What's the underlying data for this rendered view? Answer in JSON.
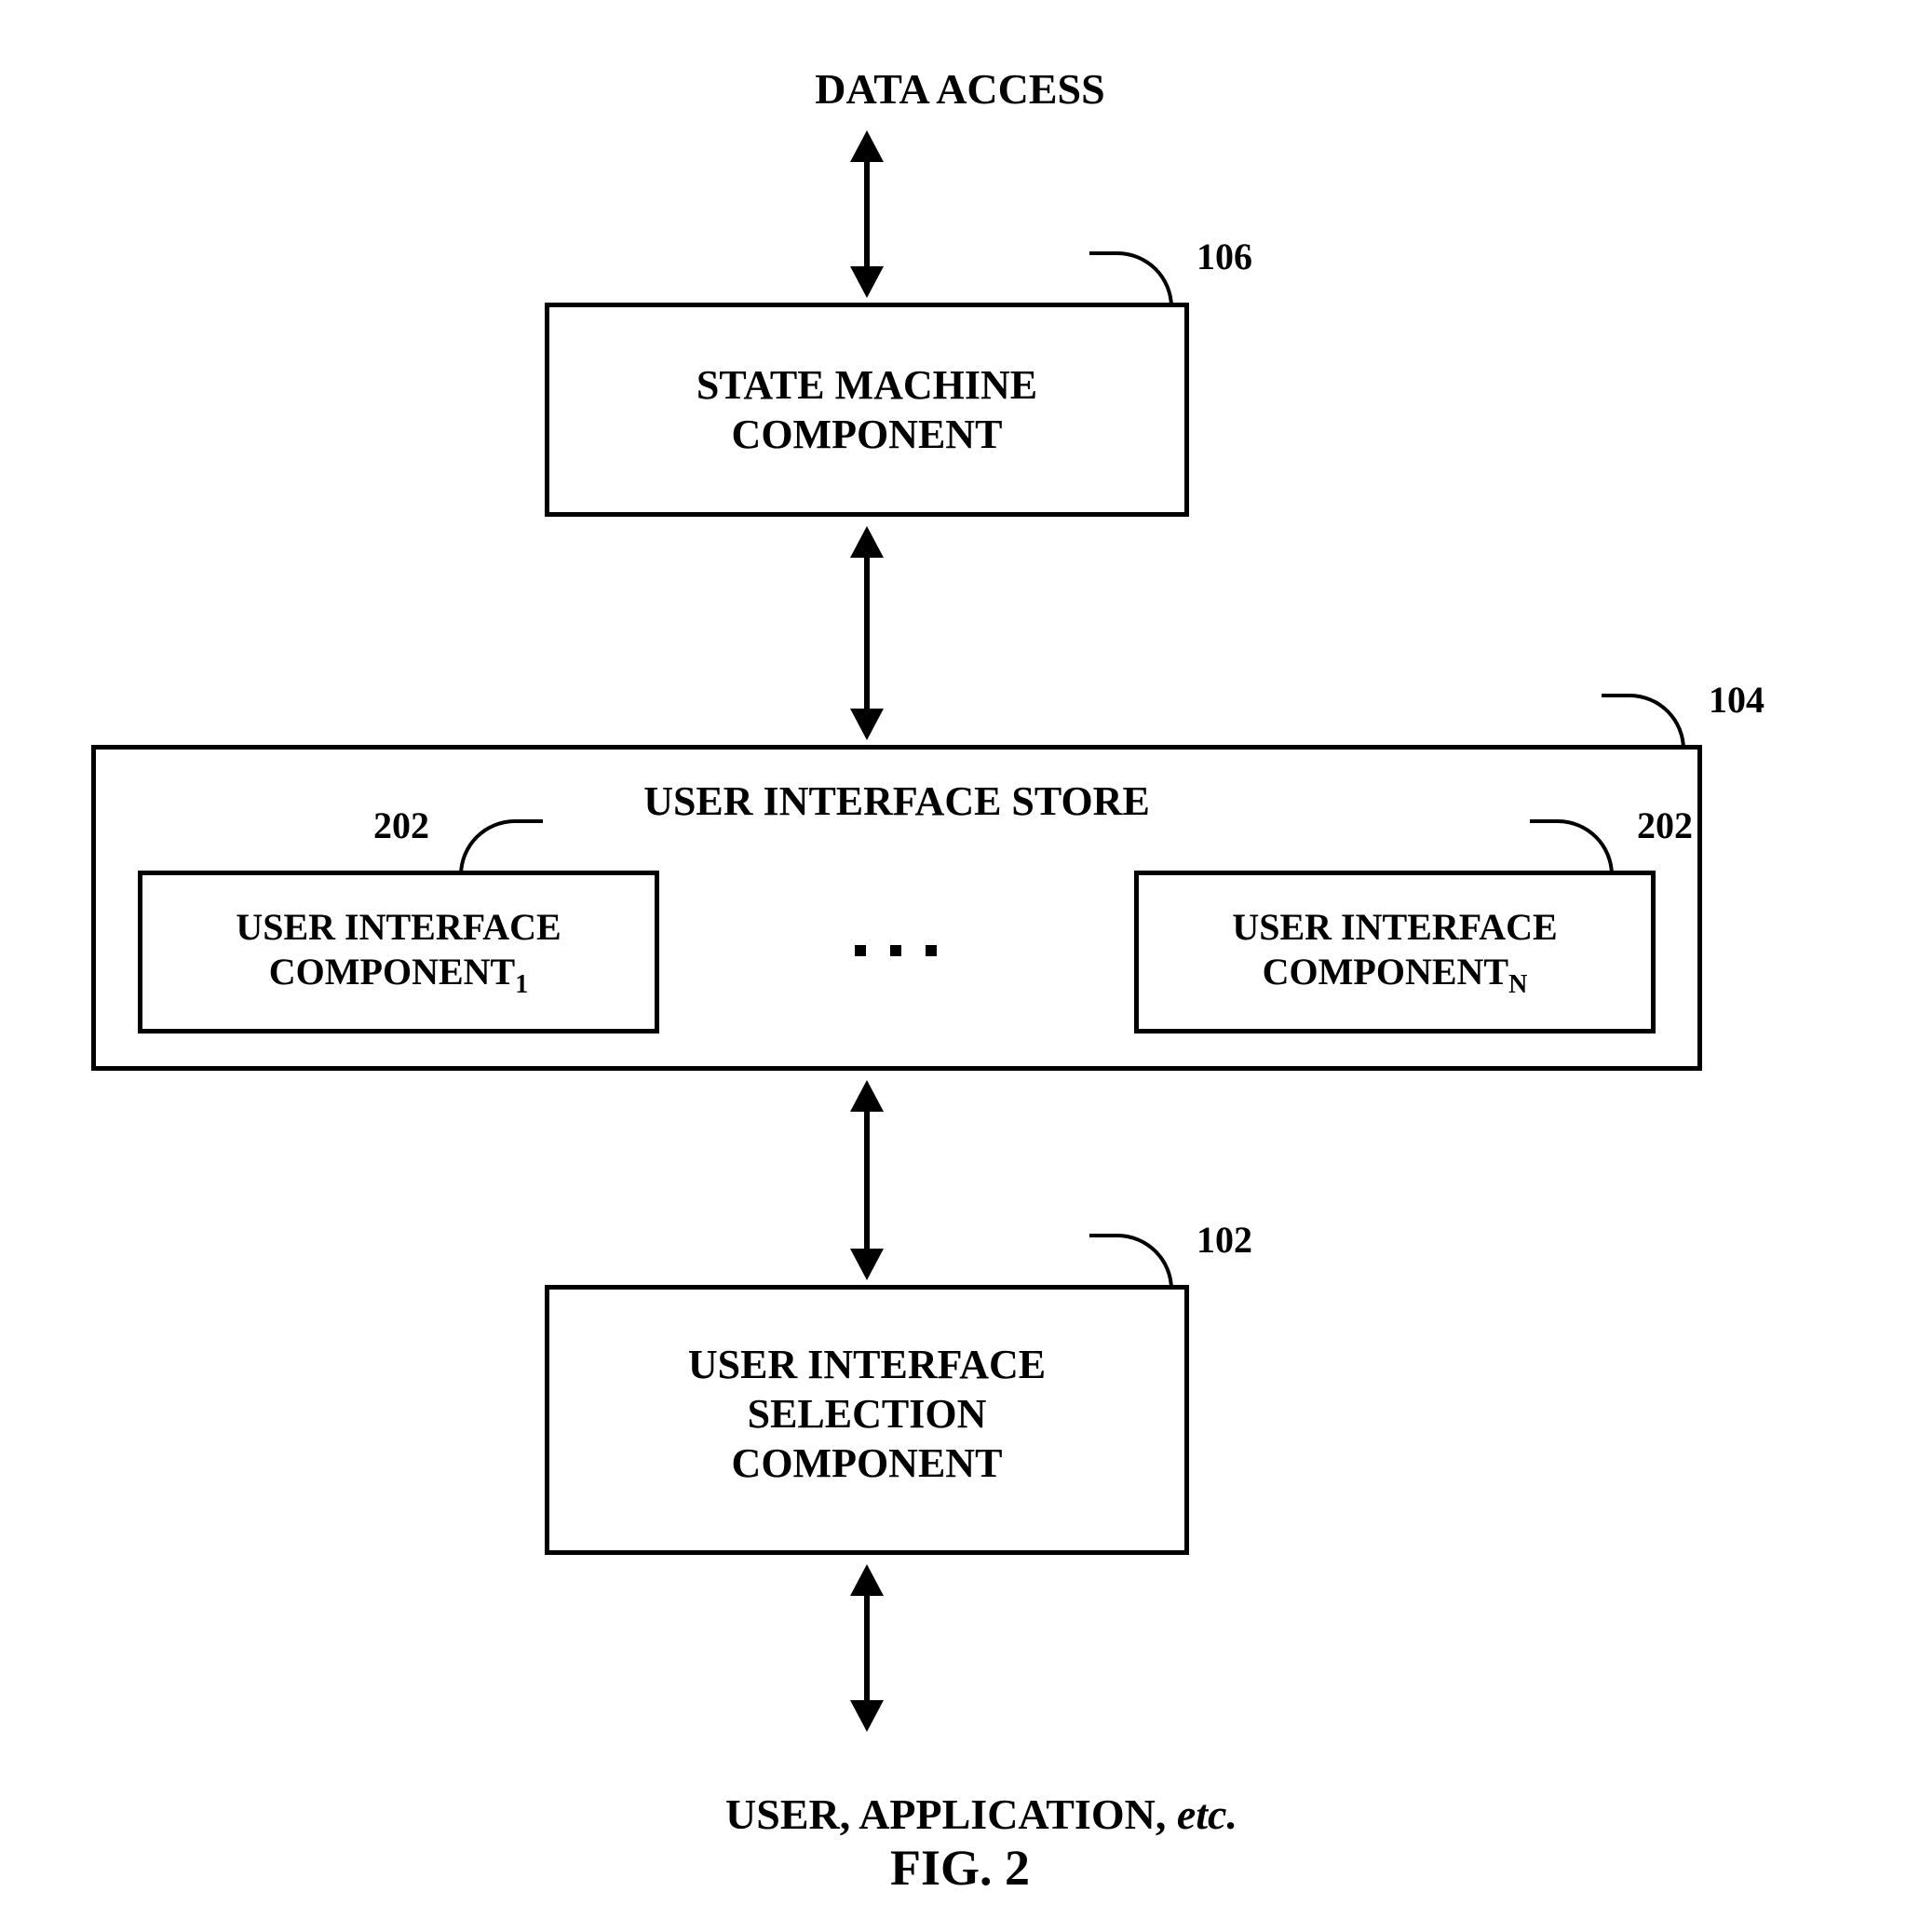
{
  "top_label": "DATA ACCESS",
  "state_machine": {
    "line1": "STATE MACHINE",
    "line2": "COMPONENT",
    "ref": "106"
  },
  "ui_store": {
    "title": "USER INTERFACE STORE",
    "ref": "104",
    "left_component": {
      "line1": "USER INTERFACE",
      "line2_prefix": "COMPONENT",
      "line2_sub": "1",
      "ref": "202"
    },
    "right_component": {
      "line1": "USER INTERFACE",
      "line2_prefix": "COMPONENT",
      "line2_sub": "N",
      "ref": "202"
    }
  },
  "selection": {
    "line1": "USER INTERFACE",
    "line2": "SELECTION",
    "line3": "COMPONENT",
    "ref": "102"
  },
  "bottom_label_plain": "USER, APPLICATION, ",
  "bottom_label_italic": "etc.",
  "figure_caption": "FIG. 2"
}
